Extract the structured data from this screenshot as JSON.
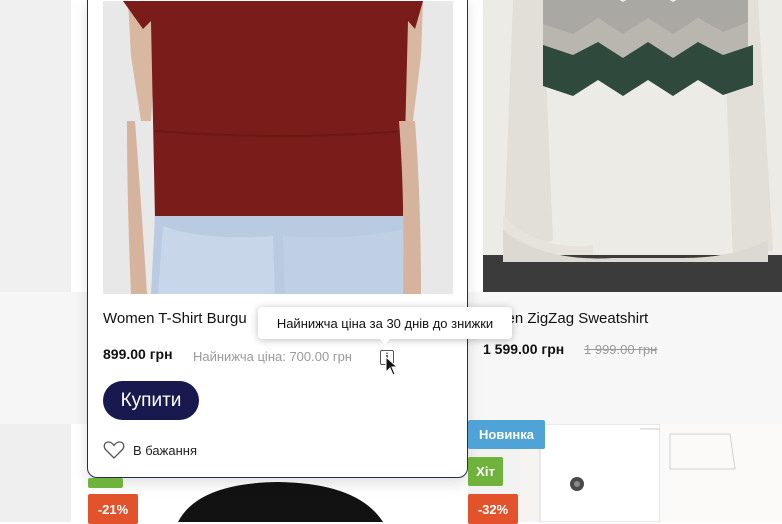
{
  "products": {
    "left": {
      "title": "Women T-Shirt Burgu",
      "price": "899.00 грн",
      "lowest_price_label": "Найнижча ціна: 700.00 грн",
      "buy_label": "Купити",
      "wishlist_label": "В бажання",
      "tooltip": "Найнижча ціна за 30 днів до знижки",
      "info_icon_glyph": "i"
    },
    "right": {
      "title": "men ZigZag Sweatshirt",
      "price": "1 599.00 грн",
      "old_price": "1 999.00 грн"
    }
  },
  "badges": {
    "new": "Новинка",
    "hit": "Хіт",
    "sale_left": "-21%",
    "sale_right": "-32%"
  },
  "colors": {
    "buy_button": "#18194f",
    "card_border": "#272a52",
    "badge_new": "#4fa3d6",
    "badge_hit": "#6fb33d",
    "badge_sale": "#e2532c",
    "tshirt": "#7a1c1a"
  }
}
